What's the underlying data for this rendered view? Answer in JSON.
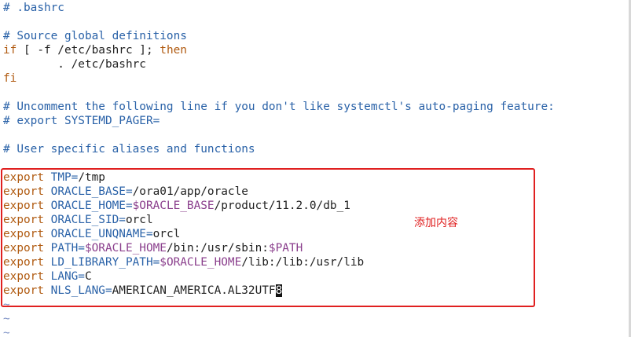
{
  "lines": [
    "# .bashrc",
    "",
    "# Source global definitions",
    {
      "kw_if": "if",
      "text_a": " [ -f /etc/bashrc ]; ",
      "kw_then": "then"
    },
    "        . /etc/bashrc",
    "fi",
    "",
    "# Uncomment the following line if you don't like systemctl's auto-paging feature:",
    "# export SYSTEMD_PAGER=",
    "",
    "# User specific aliases and functions",
    ""
  ],
  "exports": [
    {
      "keyword": "export",
      "name": "TMP=",
      "value": "/tmp"
    },
    {
      "keyword": "export",
      "name": "ORACLE_BASE=",
      "value": "/ora01/app/oracle"
    },
    {
      "keyword": "export",
      "name": "ORACLE_HOME=",
      "ref": "$ORACLE_BASE",
      "value": "/product/11.2.0/db_1"
    },
    {
      "keyword": "export",
      "name": "ORACLE_SID=",
      "value": "orcl"
    },
    {
      "keyword": "export",
      "name": "ORACLE_UNQNAME=",
      "value": "orcl"
    },
    {
      "keyword": "export",
      "name": "PATH=",
      "ref": "$ORACLE_HOME",
      "value": "/bin:/usr/sbin:",
      "ref2": "$PATH"
    },
    {
      "keyword": "export",
      "name": "LD_LIBRARY_PATH=",
      "ref": "$ORACLE_HOME",
      "value": "/lib:/lib:/usr/lib"
    },
    {
      "keyword": "export",
      "name": "LANG=",
      "value": "C"
    },
    {
      "keyword": "export",
      "name": "NLS_LANG=",
      "value": "AMERICAN_AMERICA.AL32UTF",
      "cursor_char": "8"
    }
  ],
  "empty_line_marker": "~",
  "annotation": "添加内容",
  "colors": {
    "comment": "#2a62a8",
    "keyword": "#b05a10",
    "variable": "#2a62a8",
    "reference": "#8a3e8c",
    "annotation": "#e02020"
  }
}
